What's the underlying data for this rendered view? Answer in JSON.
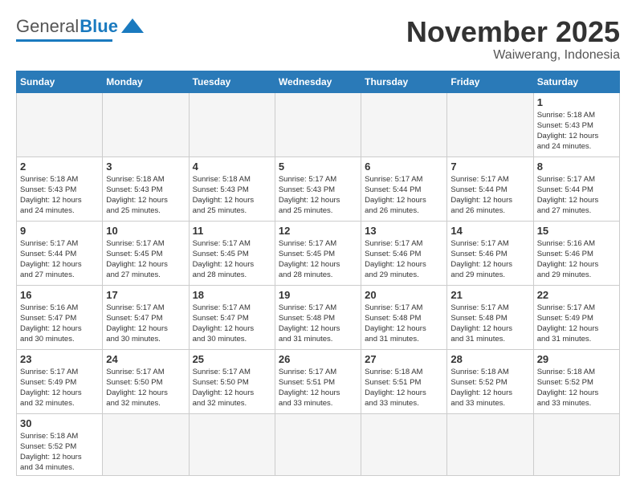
{
  "header": {
    "logo": {
      "general": "General",
      "blue": "Blue"
    },
    "title": "November 2025",
    "location": "Waiwerang, Indonesia"
  },
  "weekdays": [
    "Sunday",
    "Monday",
    "Tuesday",
    "Wednesday",
    "Thursday",
    "Friday",
    "Saturday"
  ],
  "weeks": [
    [
      {
        "day": "",
        "empty": true
      },
      {
        "day": "",
        "empty": true
      },
      {
        "day": "",
        "empty": true
      },
      {
        "day": "",
        "empty": true
      },
      {
        "day": "",
        "empty": true
      },
      {
        "day": "",
        "empty": true
      },
      {
        "day": "1",
        "info": "Sunrise: 5:18 AM\nSunset: 5:43 PM\nDaylight: 12 hours\nand 24 minutes."
      }
    ],
    [
      {
        "day": "2",
        "info": "Sunrise: 5:18 AM\nSunset: 5:43 PM\nDaylight: 12 hours\nand 24 minutes."
      },
      {
        "day": "3",
        "info": "Sunrise: 5:18 AM\nSunset: 5:43 PM\nDaylight: 12 hours\nand 25 minutes."
      },
      {
        "day": "4",
        "info": "Sunrise: 5:18 AM\nSunset: 5:43 PM\nDaylight: 12 hours\nand 25 minutes."
      },
      {
        "day": "5",
        "info": "Sunrise: 5:17 AM\nSunset: 5:43 PM\nDaylight: 12 hours\nand 25 minutes."
      },
      {
        "day": "6",
        "info": "Sunrise: 5:17 AM\nSunset: 5:44 PM\nDaylight: 12 hours\nand 26 minutes."
      },
      {
        "day": "7",
        "info": "Sunrise: 5:17 AM\nSunset: 5:44 PM\nDaylight: 12 hours\nand 26 minutes."
      },
      {
        "day": "8",
        "info": "Sunrise: 5:17 AM\nSunset: 5:44 PM\nDaylight: 12 hours\nand 27 minutes."
      }
    ],
    [
      {
        "day": "9",
        "info": "Sunrise: 5:17 AM\nSunset: 5:44 PM\nDaylight: 12 hours\nand 27 minutes."
      },
      {
        "day": "10",
        "info": "Sunrise: 5:17 AM\nSunset: 5:45 PM\nDaylight: 12 hours\nand 27 minutes."
      },
      {
        "day": "11",
        "info": "Sunrise: 5:17 AM\nSunset: 5:45 PM\nDaylight: 12 hours\nand 28 minutes."
      },
      {
        "day": "12",
        "info": "Sunrise: 5:17 AM\nSunset: 5:45 PM\nDaylight: 12 hours\nand 28 minutes."
      },
      {
        "day": "13",
        "info": "Sunrise: 5:17 AM\nSunset: 5:46 PM\nDaylight: 12 hours\nand 29 minutes."
      },
      {
        "day": "14",
        "info": "Sunrise: 5:17 AM\nSunset: 5:46 PM\nDaylight: 12 hours\nand 29 minutes."
      },
      {
        "day": "15",
        "info": "Sunrise: 5:16 AM\nSunset: 5:46 PM\nDaylight: 12 hours\nand 29 minutes."
      }
    ],
    [
      {
        "day": "16",
        "info": "Sunrise: 5:16 AM\nSunset: 5:47 PM\nDaylight: 12 hours\nand 30 minutes."
      },
      {
        "day": "17",
        "info": "Sunrise: 5:17 AM\nSunset: 5:47 PM\nDaylight: 12 hours\nand 30 minutes."
      },
      {
        "day": "18",
        "info": "Sunrise: 5:17 AM\nSunset: 5:47 PM\nDaylight: 12 hours\nand 30 minutes."
      },
      {
        "day": "19",
        "info": "Sunrise: 5:17 AM\nSunset: 5:48 PM\nDaylight: 12 hours\nand 31 minutes."
      },
      {
        "day": "20",
        "info": "Sunrise: 5:17 AM\nSunset: 5:48 PM\nDaylight: 12 hours\nand 31 minutes."
      },
      {
        "day": "21",
        "info": "Sunrise: 5:17 AM\nSunset: 5:48 PM\nDaylight: 12 hours\nand 31 minutes."
      },
      {
        "day": "22",
        "info": "Sunrise: 5:17 AM\nSunset: 5:49 PM\nDaylight: 12 hours\nand 31 minutes."
      }
    ],
    [
      {
        "day": "23",
        "info": "Sunrise: 5:17 AM\nSunset: 5:49 PM\nDaylight: 12 hours\nand 32 minutes."
      },
      {
        "day": "24",
        "info": "Sunrise: 5:17 AM\nSunset: 5:50 PM\nDaylight: 12 hours\nand 32 minutes."
      },
      {
        "day": "25",
        "info": "Sunrise: 5:17 AM\nSunset: 5:50 PM\nDaylight: 12 hours\nand 32 minutes."
      },
      {
        "day": "26",
        "info": "Sunrise: 5:17 AM\nSunset: 5:51 PM\nDaylight: 12 hours\nand 33 minutes."
      },
      {
        "day": "27",
        "info": "Sunrise: 5:18 AM\nSunset: 5:51 PM\nDaylight: 12 hours\nand 33 minutes."
      },
      {
        "day": "28",
        "info": "Sunrise: 5:18 AM\nSunset: 5:52 PM\nDaylight: 12 hours\nand 33 minutes."
      },
      {
        "day": "29",
        "info": "Sunrise: 5:18 AM\nSunset: 5:52 PM\nDaylight: 12 hours\nand 33 minutes."
      }
    ],
    [
      {
        "day": "30",
        "info": "Sunrise: 5:18 AM\nSunset: 5:52 PM\nDaylight: 12 hours\nand 34 minutes."
      },
      {
        "day": "",
        "empty": true
      },
      {
        "day": "",
        "empty": true
      },
      {
        "day": "",
        "empty": true
      },
      {
        "day": "",
        "empty": true
      },
      {
        "day": "",
        "empty": true
      },
      {
        "day": "",
        "empty": true
      }
    ]
  ]
}
